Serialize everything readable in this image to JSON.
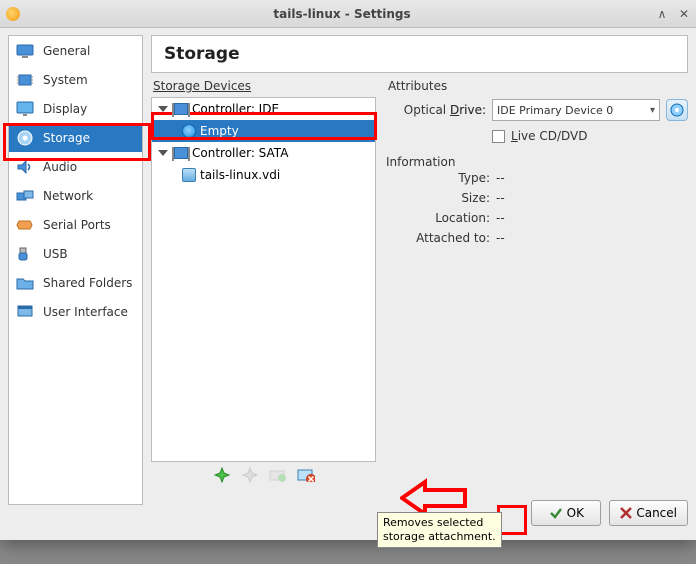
{
  "window": {
    "title": "tails-linux - Settings"
  },
  "sidebar": {
    "items": [
      {
        "label": "General",
        "icon": "monitor-icon"
      },
      {
        "label": "System",
        "icon": "chip-icon"
      },
      {
        "label": "Display",
        "icon": "display-icon"
      },
      {
        "label": "Storage",
        "icon": "storage-icon",
        "selected": true
      },
      {
        "label": "Audio",
        "icon": "audio-icon"
      },
      {
        "label": "Network",
        "icon": "network-icon"
      },
      {
        "label": "Serial Ports",
        "icon": "serial-icon"
      },
      {
        "label": "USB",
        "icon": "usb-icon"
      },
      {
        "label": "Shared Folders",
        "icon": "folder-icon"
      },
      {
        "label": "User Interface",
        "icon": "ui-icon"
      }
    ]
  },
  "header": {
    "title": "Storage"
  },
  "storage": {
    "section_label": "Storage Devices",
    "tree": [
      {
        "label": "Controller: IDE",
        "icon": "ide-chip",
        "children": [
          {
            "label": "Empty",
            "icon": "cd-blue",
            "selected": true
          }
        ]
      },
      {
        "label": "Controller: SATA",
        "icon": "sata-chip",
        "children": [
          {
            "label": "tails-linux.vdi",
            "icon": "hdd"
          }
        ]
      }
    ],
    "toolbar": {
      "add_controller": "add-controller",
      "remove_controller": "remove-controller",
      "add_attachment": "add-attachment",
      "remove_attachment": "remove-attachment"
    }
  },
  "attributes": {
    "section_label": "Attributes",
    "optical_drive_label": "Optical Drive:",
    "optical_drive_value": "IDE Primary Device 0",
    "live_cd_label": "Live CD/DVD",
    "live_cd_checked": false
  },
  "information": {
    "section_label": "Information",
    "rows": [
      {
        "k": "Type:",
        "v": "--"
      },
      {
        "k": "Size:",
        "v": "--"
      },
      {
        "k": "Location:",
        "v": "--"
      },
      {
        "k": "Attached to:",
        "v": "--"
      }
    ]
  },
  "buttons": {
    "ok": "OK",
    "cancel": "Cancel"
  },
  "tooltip": {
    "text": "Removes selected storage attachment."
  }
}
